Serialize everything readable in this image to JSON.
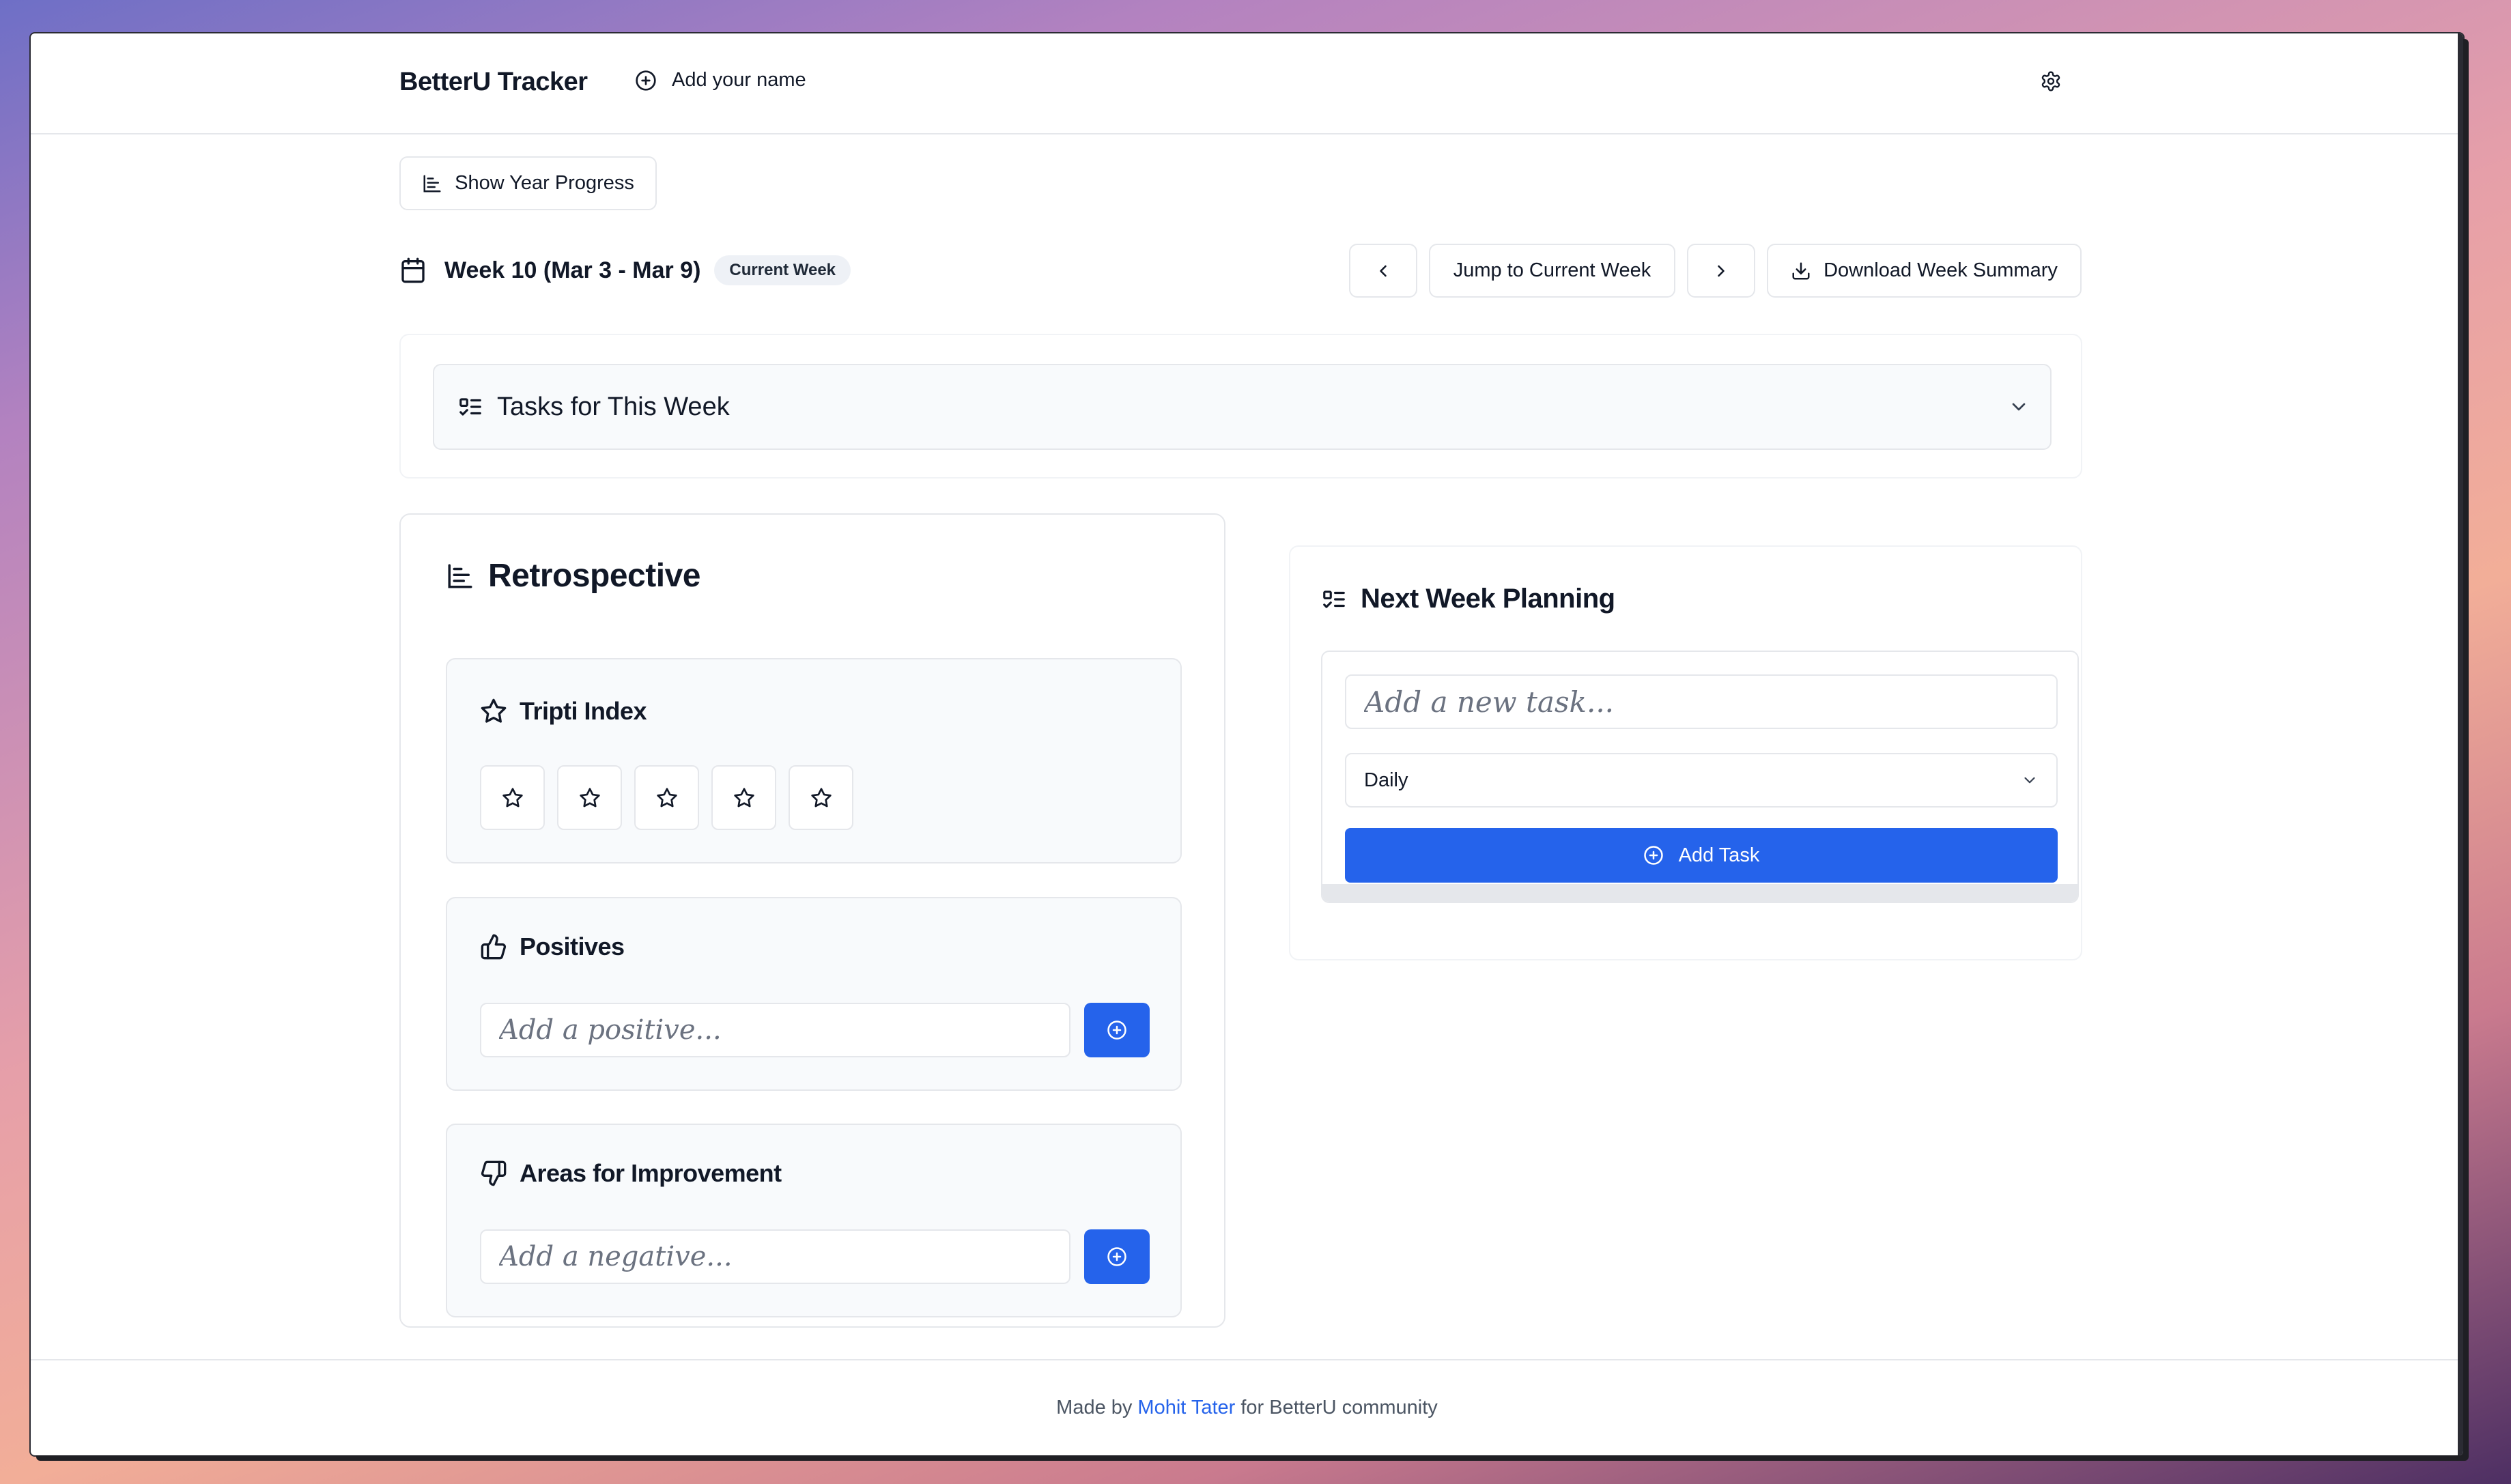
{
  "header": {
    "brand": "BetterU Tracker",
    "add_name_label": "Add your name"
  },
  "toolbar": {
    "year_progress_label": "Show Year Progress",
    "jump_label": "Jump to Current Week",
    "download_label": "Download Week Summary"
  },
  "week": {
    "title": "Week 10 (Mar 3 - Mar 9)",
    "badge": "Current Week"
  },
  "tasks_section": {
    "title": "Tasks for This Week"
  },
  "retrospective": {
    "title": "Retrospective",
    "tripti": {
      "title": "Tripti Index",
      "rating": 0,
      "max": 5
    },
    "positives": {
      "title": "Positives",
      "placeholder": "Add a positive..."
    },
    "improvement": {
      "title": "Areas for Improvement",
      "placeholder": "Add a negative..."
    }
  },
  "planning": {
    "title": "Next Week Planning",
    "task_placeholder": "Add a new task...",
    "frequency": "Daily",
    "add_label": "Add Task"
  },
  "footer": {
    "prefix": "Made by",
    "author": "Mohit Tater",
    "suffix": "for BetterU community"
  },
  "colors": {
    "primary": "#2563eb",
    "text": "#111827",
    "muted": "#6b7280",
    "border": "#e5e7eb",
    "card_bg": "#f8fafc"
  },
  "icons": {
    "add_name": "plus-circle-icon",
    "settings": "gear-icon",
    "year_progress": "bar-chart-icon",
    "calendar": "calendar-icon",
    "tasks": "checklist-icon",
    "expand": "chevron-down-icon",
    "tripti": "star-icon",
    "positives": "thumbs-up-icon",
    "improvement": "thumbs-down-icon",
    "download": "download-icon"
  }
}
